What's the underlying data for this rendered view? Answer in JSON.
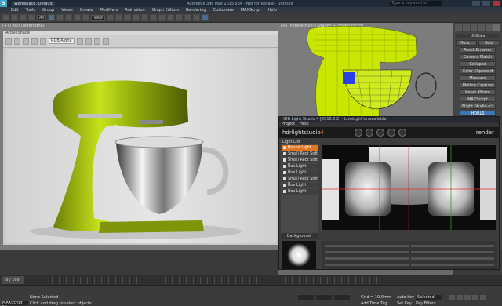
{
  "titlebar": {
    "workspace": "Workspace: Default",
    "doc_title": "Autodesk 3ds Max 2015 x64 · Not for Resale · Untitled",
    "search_placeholder": "Type a keyword or phrase"
  },
  "menu": [
    "Edit",
    "Tools",
    "Group",
    "Views",
    "Create",
    "Modifiers",
    "Animation",
    "Graph Editors",
    "Rendering",
    "Customize",
    "MAXScript",
    "Help"
  ],
  "toolbar": {
    "selection_set": "All",
    "view": "View"
  },
  "viewports": {
    "left_label": "[+] [Top] [Wireframe]",
    "right_label": "[+] [Perspective] [Shaded + Edged Faces]"
  },
  "render_window": {
    "title": "ActiveShade",
    "channel": "RGB Alpha"
  },
  "command_panel": {
    "header": "Utilities",
    "more": "More...",
    "sets": "Sets",
    "utilities": [
      "Asset Browser",
      "Camera Match",
      "Collapse",
      "Color Clipboard",
      "Measure",
      "Motion Capture",
      "Reset XForm",
      "MAXScript",
      "Flight Studio (c)",
      "HDRLS"
    ],
    "active": "HDRLS"
  },
  "hdrls": {
    "title": "HDR Light Studio 4 [2015.0.2] · LiveLight Unavailable",
    "menu": [
      "Project",
      "Help"
    ],
    "brand": "hdrlightstudio",
    "brand_suffix": "4",
    "render": "render",
    "light_list_title": "Light List",
    "lights": [
      "Round Light",
      "Small Rect Soft Bo...",
      "Small Rect Soft Bo...",
      "Box Light",
      "Box Light",
      "Small Rect Soft Bo...",
      "Box Light",
      "Box Light"
    ],
    "active_light": "Round Light",
    "background": "Background"
  },
  "status": {
    "maxscript": "MAXScript Mi:",
    "line1": "None Selected",
    "line2": "Click and drag to select objects",
    "grid": "Grid = 10.0mm",
    "add_time_tag": "Add Time Tag",
    "auto_key": "Auto Key",
    "selected": "Selected",
    "set_key": "Set Key",
    "key_filters": "Key Filters..."
  },
  "timeline": {
    "position": "0 / 100"
  }
}
